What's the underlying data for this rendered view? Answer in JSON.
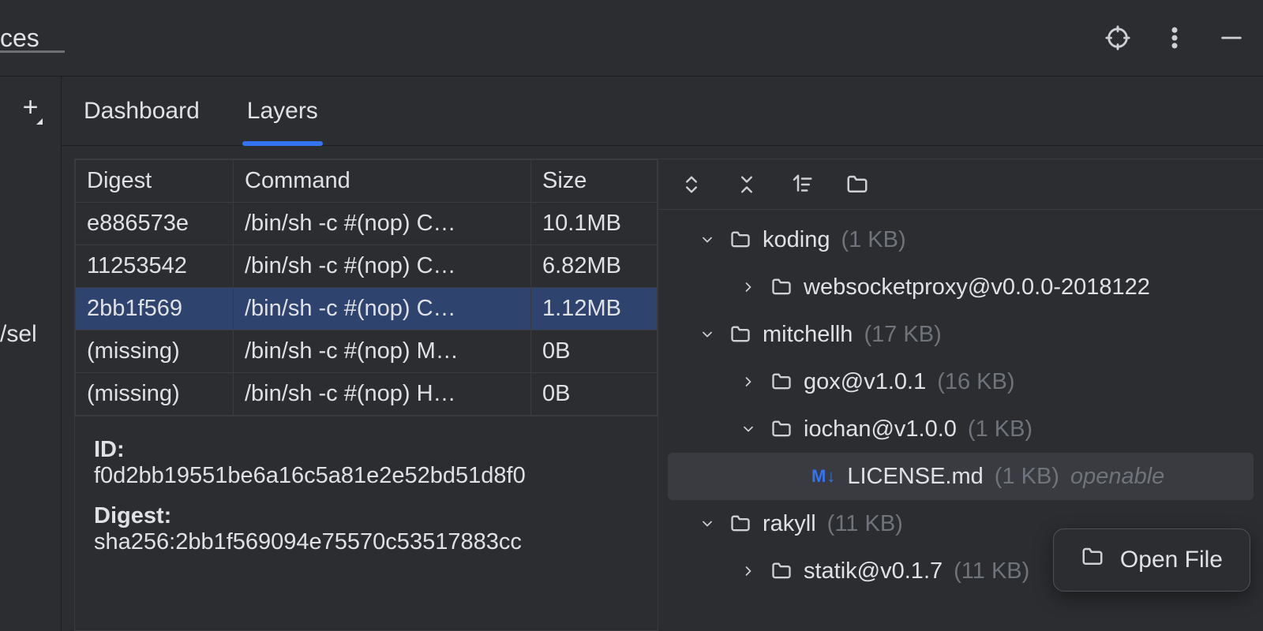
{
  "topbar": {
    "left_partial": "ces",
    "tooltip_target": "target",
    "tooltip_more": "more",
    "tooltip_min": "minimize"
  },
  "left_gutter": {
    "add_label": "+",
    "truncated_path": "/sel"
  },
  "tabs": {
    "dashboard": "Dashboard",
    "layers": "Layers"
  },
  "table": {
    "headers": {
      "digest": "Digest",
      "command": "Command",
      "size": "Size"
    },
    "rows": [
      {
        "digest": "e886573e",
        "command": "/bin/sh -c #(nop) C…",
        "size": "10.1MB"
      },
      {
        "digest": "11253542",
        "command": "/bin/sh -c #(nop) C…",
        "size": "6.82MB"
      },
      {
        "digest": "2bb1f569",
        "command": "/bin/sh -c #(nop) C…",
        "size": "1.12MB",
        "selected": true
      },
      {
        "digest": "(missing)",
        "command": "/bin/sh -c #(nop) M…",
        "size": "0B"
      },
      {
        "digest": "(missing)",
        "command": "/bin/sh -c #(nop) H…",
        "size": "0B"
      }
    ]
  },
  "details": {
    "id_label": "ID:",
    "id_value": "f0d2bb19551be6a16c5a81e2e52bd51d8f0",
    "digest_label": "Digest:",
    "digest_value": "sha256:2bb1f569094e75570c53517883cc"
  },
  "tree": [
    {
      "depth": 0,
      "exp": true,
      "type": "folder",
      "name": "koding",
      "meta": "(1 KB)"
    },
    {
      "depth": 1,
      "exp": false,
      "type": "folder",
      "name": "websocketproxy@v0.0.0-2018122",
      "meta": ""
    },
    {
      "depth": 0,
      "exp": true,
      "type": "folder",
      "name": "mitchellh",
      "meta": "(17 KB)"
    },
    {
      "depth": 1,
      "exp": false,
      "type": "folder",
      "name": "gox@v1.0.1",
      "meta": "(16 KB)"
    },
    {
      "depth": 1,
      "exp": true,
      "type": "folder",
      "name": "iochan@v1.0.0",
      "meta": "(1 KB)"
    },
    {
      "depth": 2,
      "type": "file-md",
      "name": "LICENSE.md",
      "meta": "(1 KB)",
      "meta2": "openable",
      "selected": true
    },
    {
      "depth": 0,
      "exp": true,
      "type": "folder",
      "name": "rakyll",
      "meta": "(11 KB)"
    },
    {
      "depth": 1,
      "exp": false,
      "type": "folder",
      "name": "statik@v0.1.7",
      "meta": "(11 KB)"
    }
  ],
  "context_menu": {
    "open_file": "Open File"
  }
}
